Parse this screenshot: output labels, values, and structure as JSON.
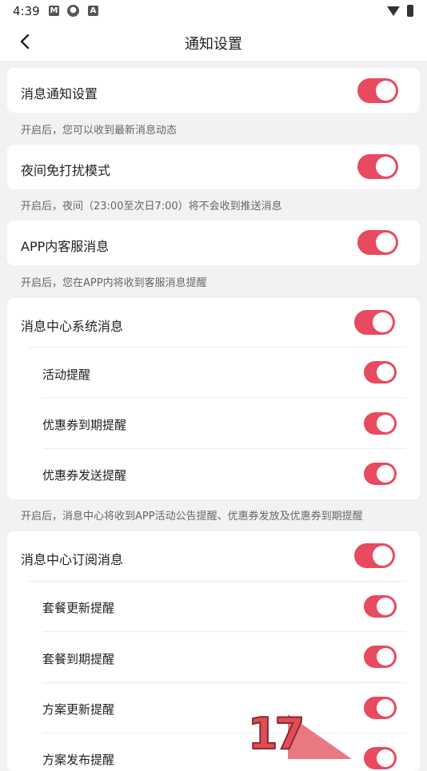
{
  "status_bar": {
    "time": "4:39",
    "icon1": "M",
    "icon2": "●",
    "icon3": "A"
  },
  "nav": {
    "title": "通知设置"
  },
  "sections": [
    {
      "label": "消息通知设置",
      "on": true,
      "hint": "开启后，您可以收到最新消息动态"
    },
    {
      "label": "夜间免打扰模式",
      "on": true,
      "hint": "开启后，夜间（23:00至次日7:00）将不会收到推送消息"
    },
    {
      "label": "APP内客服消息",
      "on": true,
      "hint": "开启后，您在APP内将收到客服消息提醒"
    }
  ],
  "system_group": {
    "label": "消息中心系统消息",
    "on": true,
    "items": [
      {
        "label": "活动提醒",
        "on": true
      },
      {
        "label": "优惠券到期提醒",
        "on": true
      },
      {
        "label": "优惠券发送提醒",
        "on": true
      }
    ],
    "hint": "开启后，消息中心将收到APP活动公告提醒、优惠券发放及优惠券到期提醒"
  },
  "subscribe_group": {
    "label": "消息中心订阅消息",
    "on": true,
    "items": [
      {
        "label": "套餐更新提醒",
        "on": true
      },
      {
        "label": "套餐到期提醒",
        "on": true
      },
      {
        "label": "方案更新提醒",
        "on": true
      },
      {
        "label": "方案发布提醒",
        "on": true
      }
    ]
  },
  "watermark": {
    "text": "17"
  },
  "colors": {
    "accent": "#e84a5f",
    "background": "#f2f2f4",
    "card": "#ffffff"
  }
}
